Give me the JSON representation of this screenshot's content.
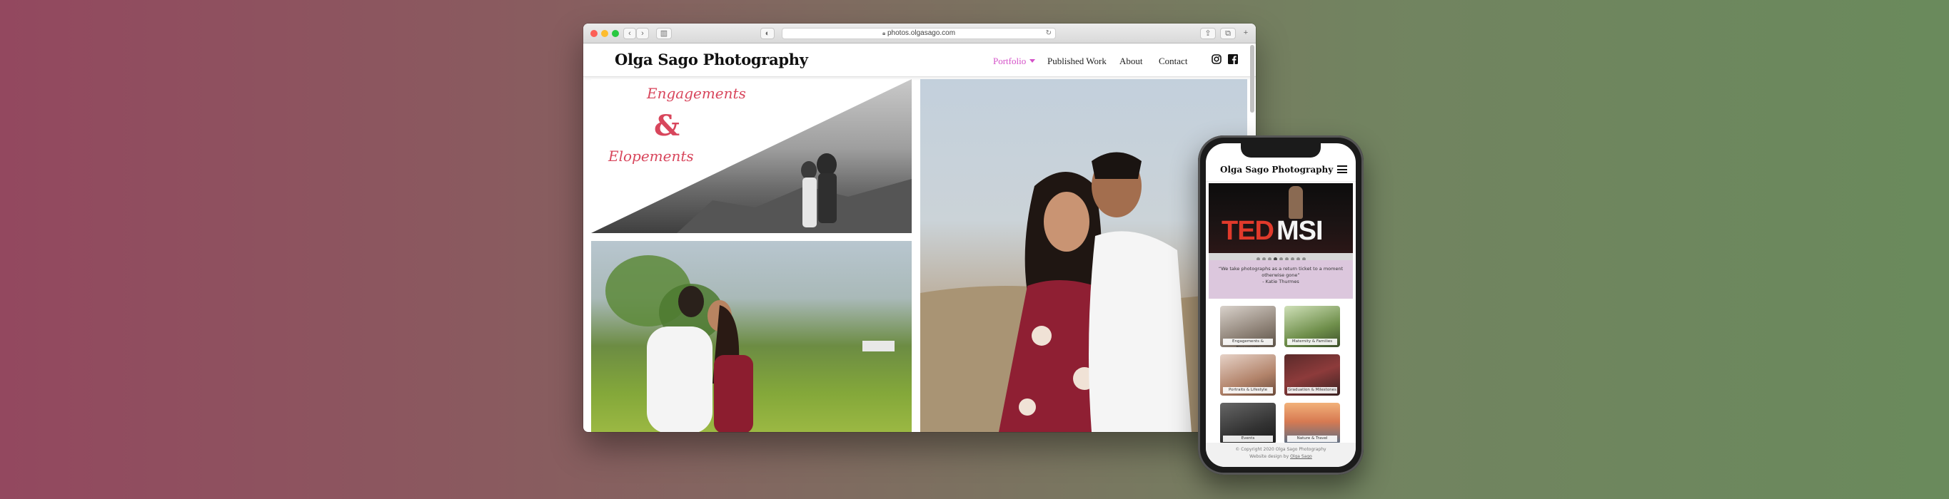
{
  "browser": {
    "url": "photos.olgasago.com"
  },
  "site": {
    "logo": "Olga Sago Photography",
    "nav": [
      {
        "label": "Portfolio",
        "active": true
      },
      {
        "label": "Published Work"
      },
      {
        "label": "About"
      },
      {
        "label": "Contact"
      }
    ],
    "accent_color": "#d450c8",
    "gallery": {
      "first_tile_text_top": "Engagements",
      "first_tile_text_amp": "&",
      "first_tile_text_bottom": "Elopements"
    }
  },
  "mobile": {
    "logo": "Olga Sago Photography",
    "hero_text": "TED",
    "hero_text_suffix": "MSI",
    "quote": "“We take photographs as a return ticket to a moment otherwise gone”",
    "quote_author": "- Katie Thurmes",
    "tiles": [
      {
        "label": "Engagements & Elopements"
      },
      {
        "label": "Maternity & Families"
      },
      {
        "label": "Portraits & Lifestyle"
      },
      {
        "label": "Graduation & Milestones"
      },
      {
        "label": "Events"
      },
      {
        "label": "Nature & Travel"
      }
    ],
    "footer_copyright": "© Copyright 2020 Olga Sago Photography",
    "footer_design_prefix": "Website design by",
    "footer_design_link": "Olga Sago"
  }
}
